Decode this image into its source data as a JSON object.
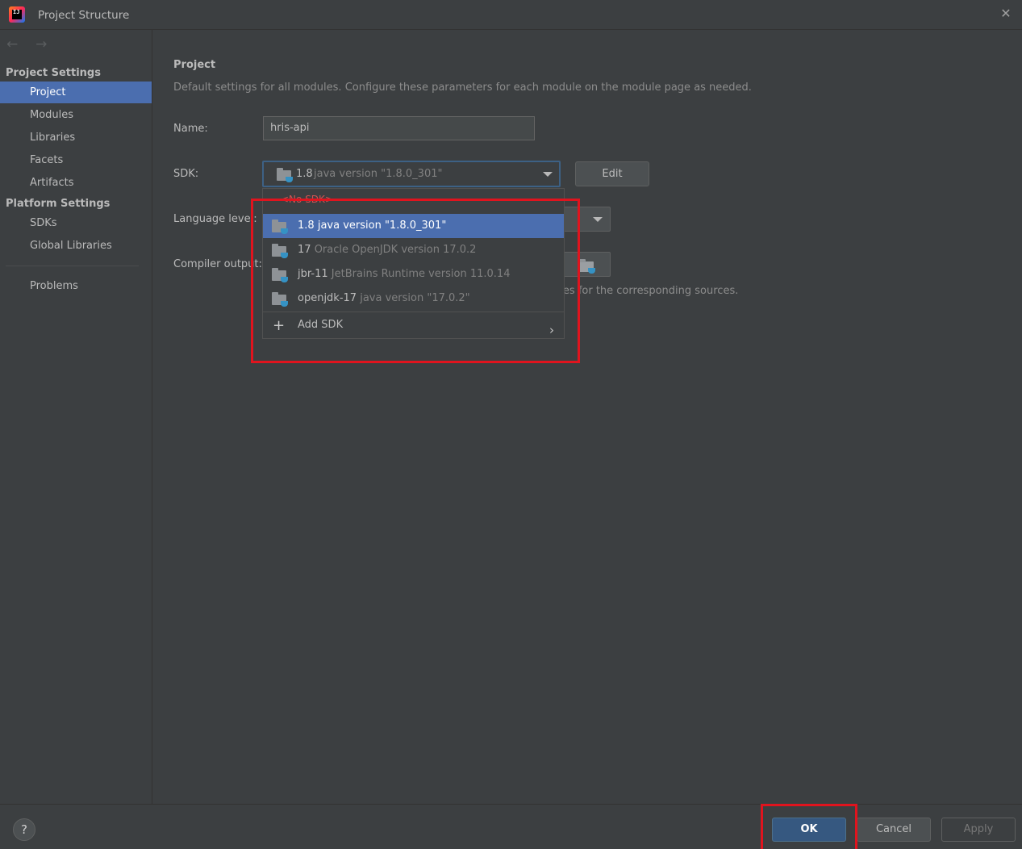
{
  "window": {
    "title": "Project Structure",
    "app_icon_letters": "IJ"
  },
  "sidebar": {
    "project_settings_header": "Project Settings",
    "project_items": [
      "Project",
      "Modules",
      "Libraries",
      "Facets",
      "Artifacts"
    ],
    "platform_settings_header": "Platform Settings",
    "platform_items": [
      "SDKs",
      "Global Libraries"
    ],
    "problems_label": "Problems",
    "selected": "Project"
  },
  "main": {
    "heading": "Project",
    "description": "Default settings for all modules. Configure these parameters for each module on the module page as needed.",
    "name_label": "Name:",
    "name_value": "hris-api",
    "sdk_label": "SDK:",
    "sdk_selected_name": "1.8",
    "sdk_selected_detail": "java version \"1.8.0_301\"",
    "edit_label": "Edit",
    "language_level_label": "Language level:",
    "compiler_output_label": "Compiler output:",
    "compiler_hint_tail": "ories for the corresponding sources."
  },
  "sdk_dropdown": {
    "no_sdk": "<No SDK>",
    "items": [
      {
        "name": "1.8",
        "detail": "java version \"1.8.0_301\"",
        "selected": true
      },
      {
        "name": "17",
        "detail": "Oracle OpenJDK version 17.0.2",
        "selected": false
      },
      {
        "name": "jbr-11",
        "detail": "JetBrains Runtime version 11.0.14",
        "selected": false
      },
      {
        "name": "openjdk-17",
        "detail": "java version \"17.0.2\"",
        "selected": false
      }
    ],
    "add_sdk": "Add SDK"
  },
  "footer": {
    "help_symbol": "?",
    "ok_label": "OK",
    "cancel_label": "Cancel",
    "apply_label": "Apply"
  },
  "colors": {
    "background": "#3c3f41",
    "selection": "#4b6eaf",
    "ok_button": "#365880",
    "annotation_red": "#e0141e"
  }
}
